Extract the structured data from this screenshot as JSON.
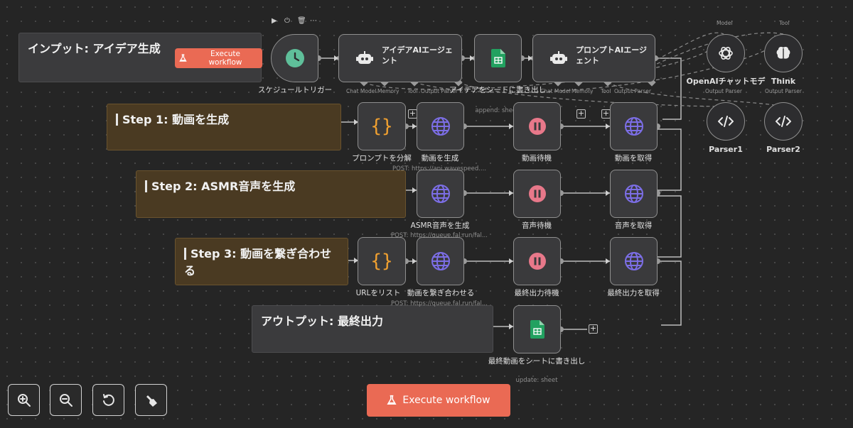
{
  "stickies": {
    "input": "インプット: アイデア生成",
    "step1": "Step 1: 動画を生成",
    "step2": "Step 2: ASMR音声を生成",
    "step3": "Step 3: 動画を繋ぎ合わせる",
    "output": "アウトプット: 最終出力"
  },
  "execute_small": "Execute workflow",
  "execute_main": "Execute workflow",
  "toolbar_icons": [
    "play-icon",
    "power-icon",
    "trash-icon",
    "more-icon"
  ],
  "nodes": {
    "schedule": {
      "label": "スケジュールトリガー"
    },
    "idea_agent": {
      "title": "アイデアAIエージェント",
      "port1": "Chat Model",
      "port2": "Memory",
      "port3": "Tool",
      "port4": "Output Parser"
    },
    "idea_sheet": {
      "label": "アイデアをシートに書き出し",
      "sub": "append: sheet"
    },
    "prompt_agent": {
      "title": "プロンプトAIエージェント",
      "port1": "Chat Model",
      "port2": "Memory",
      "port3": "Tool",
      "port4": "Output Parser"
    },
    "openai": {
      "label": "OpenAIチャットモデ",
      "top": "Model"
    },
    "think": {
      "label": "Think",
      "top": "Tool"
    },
    "parser1": {
      "label": "Parser1",
      "top": "Output Parser"
    },
    "parser2": {
      "label": "Parser2",
      "top": "Output Parser"
    },
    "split_prompt": {
      "label": "プロンプトを分解"
    },
    "gen_video": {
      "label": "動画を生成",
      "sub": "POST: https://api.wavespeed...."
    },
    "wait_video": {
      "label": "動画待機"
    },
    "get_video": {
      "label": "動画を取得"
    },
    "gen_audio": {
      "label": "ASMR音声を生成",
      "sub": "POST: https://queue.fal.run/fal..."
    },
    "wait_audio": {
      "label": "音声待機"
    },
    "get_audio": {
      "label": "音声を取得"
    },
    "url_list": {
      "label": "URLをリスト"
    },
    "merge_video": {
      "label": "動画を繋ぎ合わせる",
      "sub": "POST: https://queue.fal.run/fal..."
    },
    "wait_final": {
      "label": "最終出力待機"
    },
    "get_final": {
      "label": "最終出力を取得"
    },
    "final_sheet": {
      "label": "最終動画をシートに書き出し",
      "sub": "update: sheet"
    }
  },
  "controls": [
    "zoom-in-icon",
    "zoom-out-icon",
    "reset-icon",
    "tidy-up-icon"
  ],
  "colors": {
    "canvas": "#252525",
    "execute": "#ea6a54",
    "http": "#7c6ee6",
    "wait": "#e8788a",
    "code": "#f0a030",
    "sheets": "#22a160",
    "schedule": "#5fbf9a"
  }
}
